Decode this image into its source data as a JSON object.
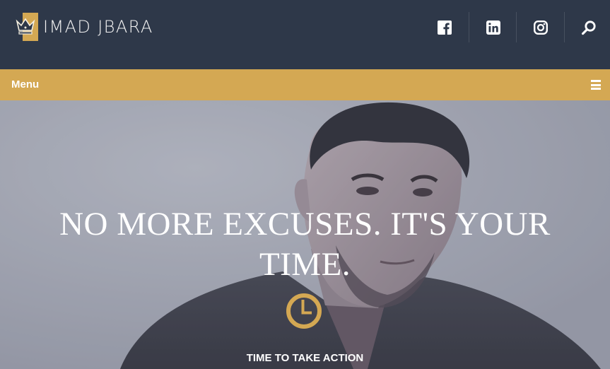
{
  "brand": {
    "name": "IMAD JBARA",
    "logo_icon": "crown-icon",
    "accent": "#d4a853"
  },
  "header": {
    "social": [
      {
        "name": "facebook-icon",
        "label": "Facebook"
      },
      {
        "name": "linkedin-icon",
        "label": "LinkedIn"
      },
      {
        "name": "instagram-icon",
        "label": "Instagram"
      }
    ],
    "search_icon": "search-icon",
    "bg": "#2e3849"
  },
  "menu": {
    "label": "Menu",
    "icon": "hamburger-icon"
  },
  "hero": {
    "title": "NO MORE EXCUSES. IT'S YOUR TIME.",
    "icon": "clock-icon",
    "subtitle": "TIME TO TAKE ACTION"
  }
}
